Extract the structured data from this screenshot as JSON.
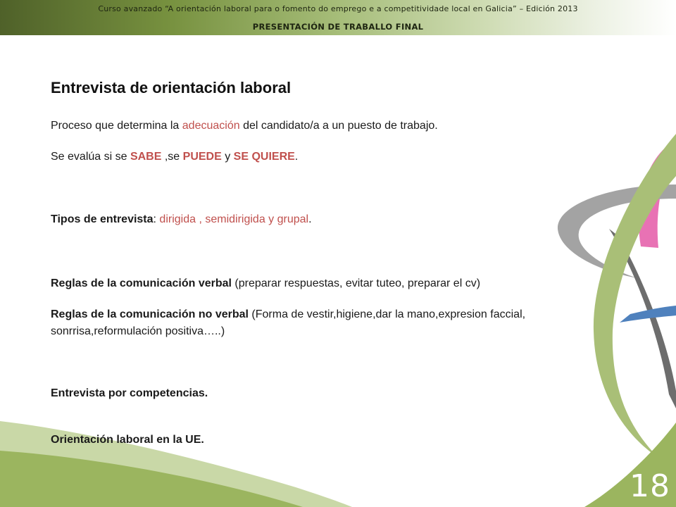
{
  "header": {
    "course": "Curso avanzado “A orientación laboral para o fomento do emprego e a competitividade local en Galicia” – Edición 2013",
    "section": "PRESENTACIÓN DE TRABALLO FINAL"
  },
  "slide": {
    "title": "Entrevista de orientación laboral",
    "proceso": {
      "pre": "Proceso que determina la ",
      "highlight": "adecuación",
      "post": " del candidato/a a un puesto de trabajo."
    },
    "evalua": {
      "pre": "Se evalúa  si se ",
      "sabe": "SABE",
      "mid1": " ,se ",
      "puede": "PUEDE",
      "mid2": " y ",
      "quiere": "SE QUIERE",
      "post": "."
    },
    "tipos": {
      "label": "Tipos de entrevista",
      "colon": ": ",
      "values": "dirigida ,  semidirigida  y  grupal",
      "post": "."
    },
    "verbal": {
      "label": "Reglas de la comunicación verbal",
      "detail": " (preparar respuestas, evitar tuteo, preparar el cv)"
    },
    "noverbal": {
      "label": "Reglas de la comunicación no verbal",
      "detail": " (Forma de vestir,higiene,dar la mano,expresion faccial,",
      "detail2": "sonrrisa,reformulación positiva…..)"
    },
    "competencias": "Entrevista por competencias.",
    "ue": "Orientación laboral en la UE."
  },
  "page_number": "18",
  "colors": {
    "accent_red": "#c0504d",
    "header_green": "#4f6129",
    "decor_green": "#9bb55f",
    "decor_pink": "#e872b4",
    "decor_gray": "#9a9a9a",
    "decor_blue": "#4f81bd"
  }
}
